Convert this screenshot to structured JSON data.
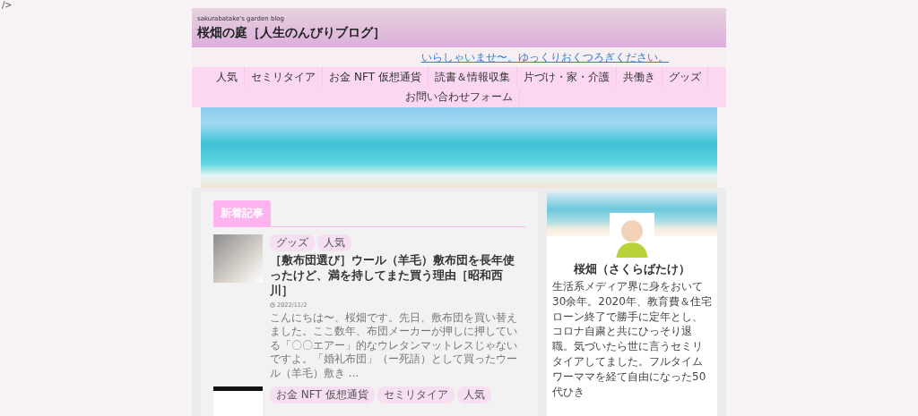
{
  "stray_text": "/>",
  "header": {
    "tagline": "sakurabatake's garden blog",
    "title": "桜畑の庭［人生のんびりブログ］"
  },
  "notice": {
    "link": "いらしゃいませ〜。ゆっくりおくつろぎください。"
  },
  "nav": {
    "items": [
      "人気",
      "セミリタイア",
      "お金 NFT 仮想通貨",
      "読書＆情報収集",
      "片づけ・家・介護",
      "共働き",
      "グッズ",
      "お問い合わせフォーム"
    ]
  },
  "main": {
    "section_title": "新着記事",
    "articles": [
      {
        "kind": "cat",
        "tags": [
          "グッズ",
          "人気"
        ],
        "title": "［敷布団選び］ウール（羊毛）敷布団を長年使ったけど、満を持してまた買う理由［昭和西川］",
        "date": "2022/11/2",
        "excerpt": "こんにちは〜、桜畑です。先日、敷布団を買い替えました。ここ数年、布団メーカーが押しに押している「〇〇エアー」的なウレタンマットレスじゃないですよ。「婚礼布団」（ー死語）として買ったウール（羊毛）敷き ..."
      },
      {
        "kind": "doc",
        "tags": [
          "お金 NFT 仮想通貨",
          "セミリタイア",
          "人気"
        ]
      }
    ]
  },
  "sidebar": {
    "name": "桜畑（さくらばたけ）",
    "bio": "生活系メディア界に身をおいて30余年。2020年、教育費＆住宅ローン終了で勝手に定年とし、コロナ自粛と共にひっそり退職。気づいたら世に言うセミリタイアしてました。フルタイムワーママを経て自由になった50代ひき"
  }
}
